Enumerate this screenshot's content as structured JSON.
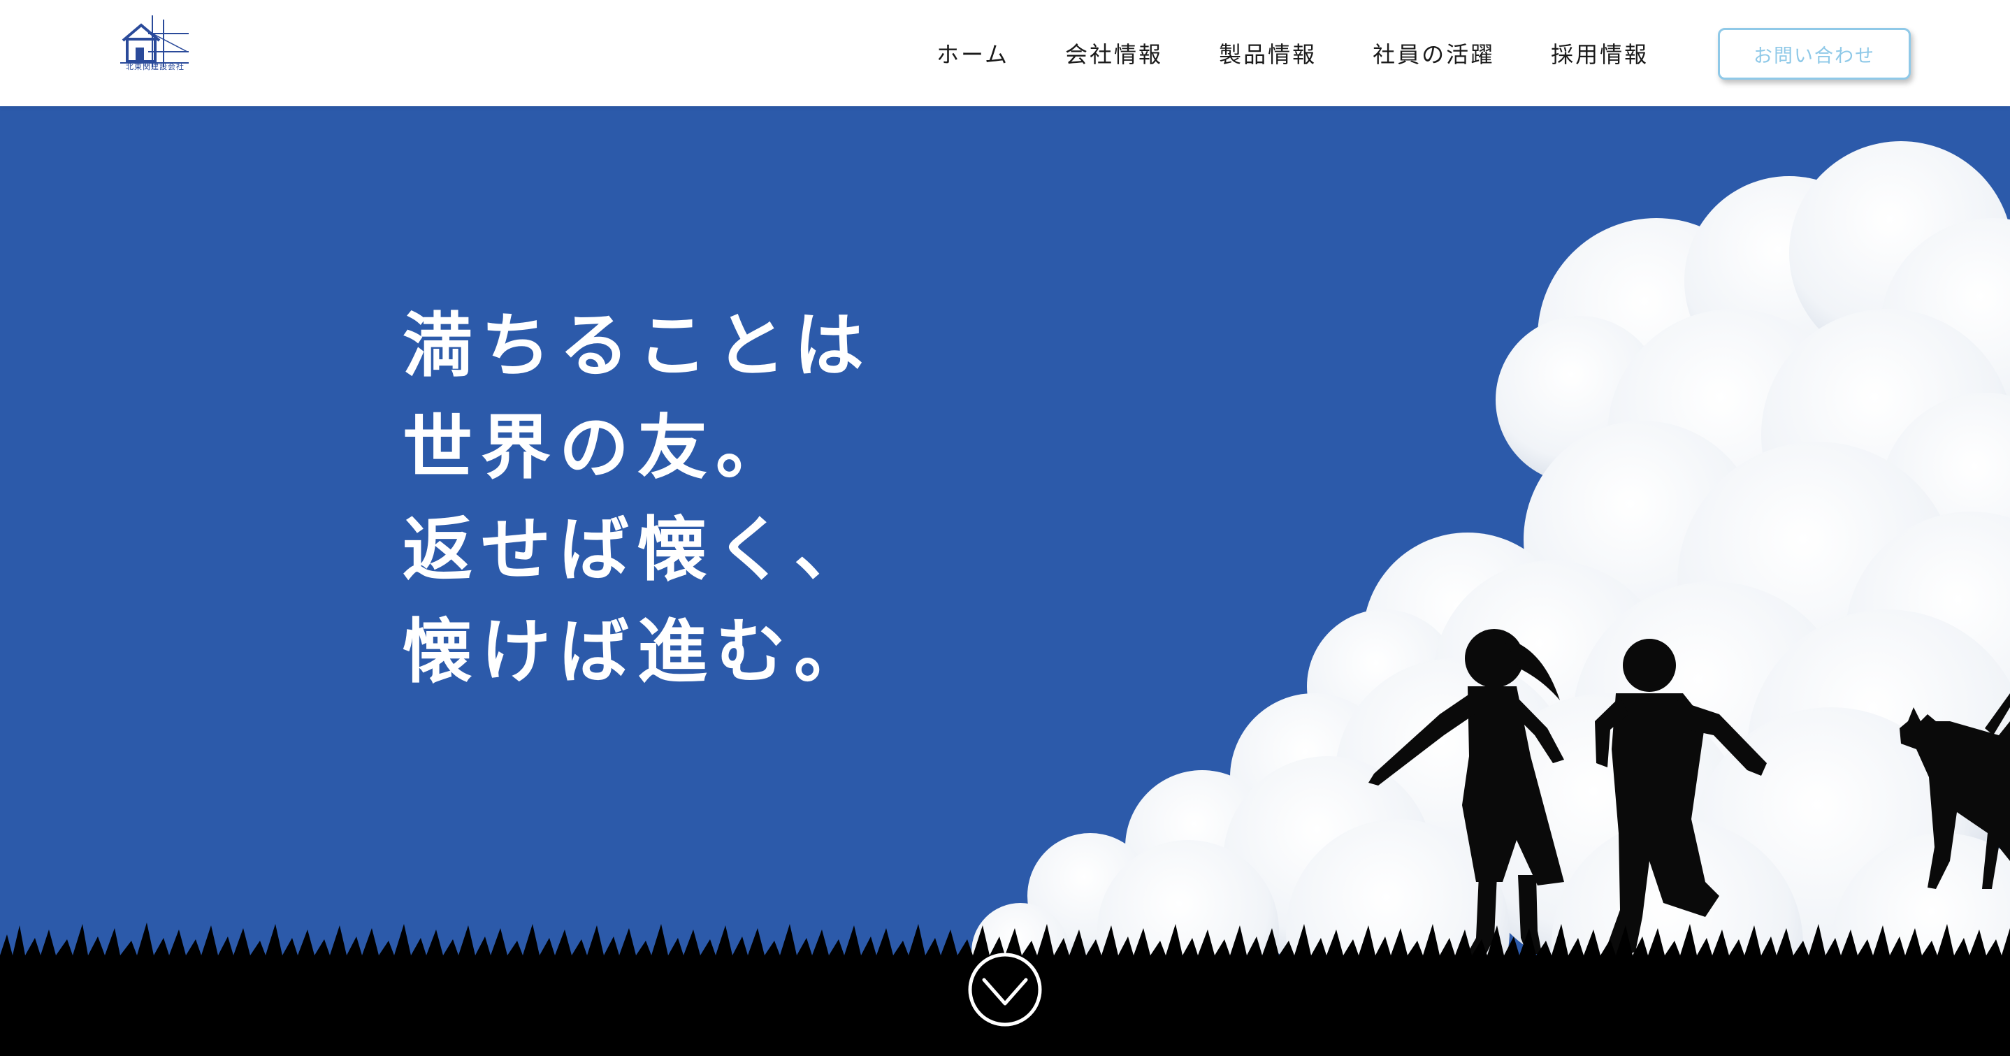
{
  "header": {
    "logo_text": "北東関建設会社",
    "nav": [
      {
        "label": "ホーム"
      },
      {
        "label": "会社情報"
      },
      {
        "label": "製品情報"
      },
      {
        "label": "社員の活躍"
      },
      {
        "label": "採用情報"
      }
    ],
    "contact_label": "お問い合わせ"
  },
  "hero": {
    "lines": [
      "満ちることは",
      "世界の友。",
      "返せば懐く、",
      "懐けば進む。"
    ]
  },
  "colors": {
    "sky": "#2c5aaa",
    "accent": "#8fc9e8",
    "logo": "#2a4a9a"
  },
  "icons": {
    "scroll": "chevron-down-circle-icon",
    "logo": "house-logo-icon"
  }
}
